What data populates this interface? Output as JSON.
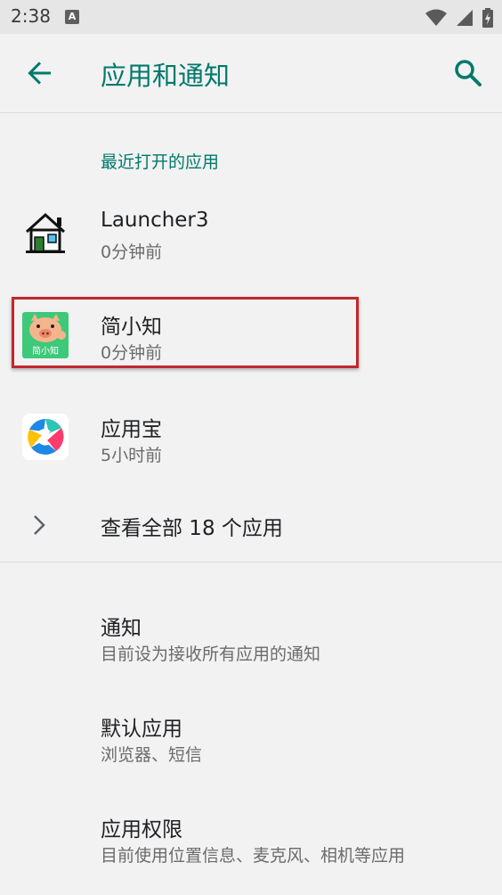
{
  "status_bar": {
    "time": "2:38",
    "notif_letter": "A",
    "icons": [
      "wifi-icon",
      "signal-icon",
      "battery-charging-icon"
    ]
  },
  "toolbar": {
    "title": "应用和通知",
    "back_icon": "back-arrow-icon",
    "search_icon": "search-icon"
  },
  "recent": {
    "header": "最近打开的应用",
    "apps": [
      {
        "name": "Launcher3",
        "time": "0分钟前",
        "icon": "launcher-house-icon"
      },
      {
        "name": "简小知",
        "time": "0分钟前",
        "icon": "jianxiaozhi-pig-icon",
        "icon_text": "简小知"
      },
      {
        "name": "应用宝",
        "time": "5小时前",
        "icon": "yingyongbao-icon"
      }
    ],
    "see_all": "查看全部 18 个应用"
  },
  "settings": [
    {
      "title": "通知",
      "subtitle": "目前设为接收所有应用的通知"
    },
    {
      "title": "默认应用",
      "subtitle": "浏览器、短信"
    },
    {
      "title": "应用权限",
      "subtitle": "目前使用位置信息、麦克风、相机等应用"
    }
  ],
  "colors": {
    "accent": "#00796b",
    "highlight": "#c1272d"
  }
}
